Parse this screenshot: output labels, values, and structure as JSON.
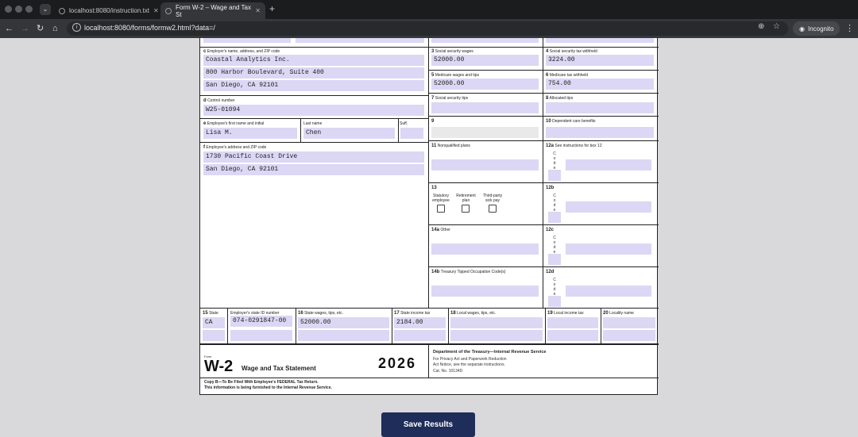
{
  "browser": {
    "tabs": [
      {
        "title": "localhost:8080/instruction.txt"
      },
      {
        "title": "Form W-2 – Wage and Tax St"
      }
    ],
    "url": "localhost:8080/forms/formw2.html?data=/",
    "profile": "Incognito"
  },
  "form": {
    "labels": {
      "c": "c",
      "c_text": "Employer's name, address, and ZIP code",
      "d": "d",
      "d_text": "Control number",
      "e": "e",
      "e_text": "Employee's first name and initial",
      "last": "Last name",
      "suff": "Suff.",
      "f": "f",
      "f_text": "Employee's address and ZIP code",
      "b3": "3",
      "b3_text": "Social security wages",
      "b4": "4",
      "b4_text": "Social security tax withheld",
      "b5": "5",
      "b5_text": "Medicare wages and tips",
      "b6": "6",
      "b6_text": "Medicare tax withheld",
      "b7": "7",
      "b7_text": "Social security tips",
      "b8": "8",
      "b8_text": "Allocated tips",
      "b9": "9",
      "b10": "10",
      "b10_text": "Dependent care benefits",
      "b11": "11",
      "b11_text": "Nonqualified plans",
      "b12a": "12a",
      "b12a_text": "See instructions for box 12",
      "b12b": "12b",
      "b12c": "12c",
      "b12d": "12d",
      "b13": "13",
      "statutory1": "Statutory",
      "statutory2": "employee",
      "retirement1": "Retirement",
      "retirement2": "plan",
      "thirdparty1": "Third-party",
      "thirdparty2": "sick pay",
      "b14a": "14a",
      "b14a_text": "Other",
      "b14b": "14b",
      "b14b_text": "Treasury Tipped Occupation Code(s)",
      "b15": "15",
      "b15_text": "State",
      "state_id": "Employer's state ID number",
      "b16": "16",
      "b16_text": "State wages, tips, etc.",
      "b17": "17",
      "b17_text": "State income tax",
      "b18": "18",
      "b18_text": "Local wages, tips, etc.",
      "b19": "19",
      "b19_text": "Local income tax",
      "b20": "20",
      "b20_text": "Locality name",
      "code": [
        "C",
        "o",
        "d",
        "e"
      ]
    },
    "values": {
      "employer_name": "Coastal Analytics Inc.",
      "employer_addr1": "800 Harbor Boulevard, Suite 400",
      "employer_addr2": "San Diego, CA 92101",
      "control_number": "W25-01094",
      "employee_first": "Lisa M.",
      "employee_last": "Chen",
      "employee_suff": "",
      "employee_addr1": "1730 Pacific Coast Drive",
      "employee_addr2": "San Diego, CA 92101",
      "ss_wages": "52000.00",
      "ss_tax": "3224.00",
      "medicare_wages": "52000.00",
      "medicare_tax": "754.00",
      "state": "CA",
      "state_id": "074-0291847-00",
      "state_wages": "52000.00",
      "state_tax": "2184.00"
    },
    "footer": {
      "form_word": "Form",
      "form_name": "W-2",
      "form_title": "Wage and Tax Statement",
      "year": "2026",
      "dept": "Department of the Treasury—Internal Revenue Service",
      "note1": "For Privacy Act and Paperwork Reduction",
      "note2": "Act Notice, see the separate instructions.",
      "cat": "Cat. No. 10134D",
      "copyb1": "Copy B—To Be Filed With Employee's FEDERAL Tax Return.",
      "copyb2": "This information is being furnished to the Internal Revenue Service."
    }
  },
  "save_button": "Save Results"
}
